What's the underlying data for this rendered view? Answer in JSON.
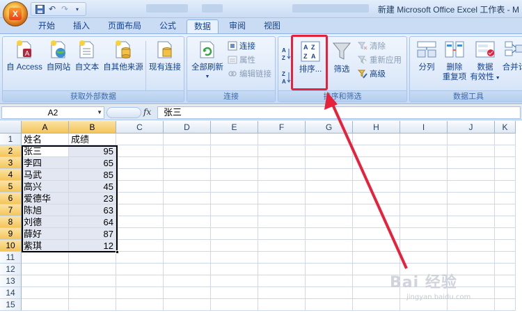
{
  "titlebar": {
    "title": "新建 Microsoft Office Excel 工作表 - M",
    "office_logo": "X"
  },
  "tabs": [
    "开始",
    "插入",
    "页面布局",
    "公式",
    "数据",
    "审阅",
    "视图"
  ],
  "active_tab": "数据",
  "ribbon": {
    "external_data": {
      "label": "获取外部数据",
      "from_access": "自 Access",
      "from_web": "自网站",
      "from_text": "自文本",
      "from_other": "自其他来源",
      "existing": "现有连接"
    },
    "connections": {
      "label": "连接",
      "refresh_all": "全部刷新",
      "connections": "连接",
      "properties": "属性",
      "edit_links": "编辑链接"
    },
    "sort_filter": {
      "label": "排序和筛选",
      "sort": "排序...",
      "filter": "筛选",
      "clear": "清除",
      "reapply": "重新应用",
      "advanced": "高级"
    },
    "data_tools": {
      "label": "数据工具",
      "text_to_columns": "分列",
      "remove_duplicates_1": "删除",
      "remove_duplicates_2": "重复项",
      "validation_1": "数据",
      "validation_2": "有效性",
      "consolidate": "合并计"
    }
  },
  "formula_bar": {
    "name_box": "A2",
    "fx": "fx",
    "content": "张三"
  },
  "columns": [
    "A",
    "B",
    "C",
    "D",
    "E",
    "F",
    "G",
    "H",
    "I",
    "J",
    "K"
  ],
  "rows": [
    "1",
    "2",
    "3",
    "4",
    "5",
    "6",
    "7",
    "8",
    "9",
    "10",
    "11",
    "12",
    "13",
    "14",
    "15"
  ],
  "sheet": {
    "header": [
      "姓名",
      "成绩"
    ],
    "data": [
      {
        "name": "张三",
        "score": "95"
      },
      {
        "name": "李四",
        "score": "65"
      },
      {
        "name": "马武",
        "score": "85"
      },
      {
        "name": "高兴",
        "score": "45"
      },
      {
        "name": "爱德华",
        "score": "23"
      },
      {
        "name": "陈旭",
        "score": "63"
      },
      {
        "name": "刘德",
        "score": "64"
      },
      {
        "name": "薛好",
        "score": "87"
      },
      {
        "name": "紫琪",
        "score": "12"
      }
    ]
  },
  "watermark": {
    "main": "Bai 经验",
    "sub": "jingyan.baidu.com"
  },
  "colors": {
    "highlight": "#e8213a",
    "ribbon_text": "#15428b",
    "selection_fill": "#e3e7f2"
  }
}
